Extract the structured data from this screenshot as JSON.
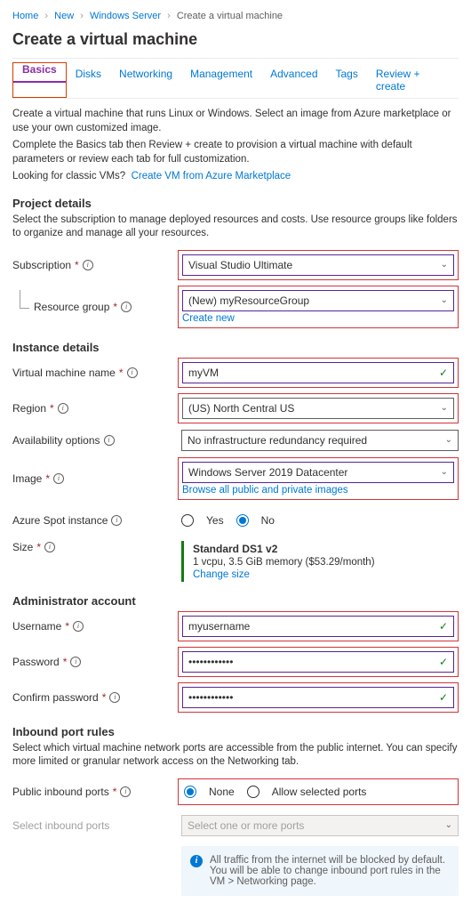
{
  "breadcrumb": {
    "home": "Home",
    "new": "New",
    "ws": "Windows Server",
    "current": "Create a virtual machine"
  },
  "page_title": "Create a virtual machine",
  "tabs": {
    "basics": "Basics",
    "disks": "Disks",
    "networking": "Networking",
    "management": "Management",
    "advanced": "Advanced",
    "tags": "Tags",
    "review": "Review + create"
  },
  "intro1": "Create a virtual machine that runs Linux or Windows. Select an image from Azure marketplace or use your own customized image.",
  "intro2": "Complete the Basics tab then Review + create to provision a virtual machine with default parameters or review each tab for full customization.",
  "classic_q": "Looking for classic VMs?",
  "classic_link": "Create VM from Azure Marketplace",
  "project": {
    "heading": "Project details",
    "desc": "Select the subscription to manage deployed resources and costs. Use resource groups like folders to organize and manage all your resources.",
    "subscription_label": "Subscription",
    "subscription_value": "Visual Studio Ultimate",
    "rg_label": "Resource group",
    "rg_value": "(New) myResourceGroup",
    "rg_create": "Create new"
  },
  "instance": {
    "heading": "Instance details",
    "name_label": "Virtual machine name",
    "name_value": "myVM",
    "region_label": "Region",
    "region_value": "(US) North Central US",
    "avail_label": "Availability options",
    "avail_value": "No infrastructure redundancy required",
    "image_label": "Image",
    "image_value": "Windows Server 2019 Datacenter",
    "image_link": "Browse all public and private images",
    "spot_label": "Azure Spot instance",
    "yes": "Yes",
    "no": "No",
    "size_label": "Size",
    "size_title": "Standard DS1 v2",
    "size_sub": "1 vcpu, 3.5 GiB memory ($53.29/month)",
    "size_change": "Change size"
  },
  "admin": {
    "heading": "Administrator account",
    "username_label": "Username",
    "username_value": "myusername",
    "password_label": "Password",
    "password_value": "••••••••••••",
    "confirm_label": "Confirm password",
    "confirm_value": "••••••••••••"
  },
  "inbound": {
    "heading": "Inbound port rules",
    "desc": "Select which virtual machine network ports are accessible from the public internet. You can specify more limited or granular network access on the Networking tab.",
    "public_label": "Public inbound ports",
    "none": "None",
    "allow": "Allow selected ports",
    "select_label": "Select inbound ports",
    "select_placeholder": "Select one or more ports",
    "info": "All traffic from the internet will be blocked by default. You will be able to change inbound port rules in the VM > Networking page."
  }
}
